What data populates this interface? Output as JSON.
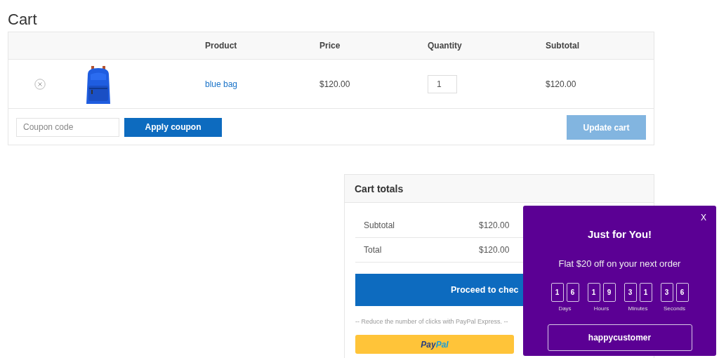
{
  "page_title": "Cart",
  "cart_table": {
    "columns": [
      {},
      {},
      {
        "label": "Product"
      },
      {
        "label": "Price"
      },
      {
        "label": "Quantity"
      },
      {
        "label": "Subtotal"
      }
    ],
    "rows": [
      {
        "product": "blue bag",
        "price": "$120.00",
        "quantity": "1",
        "subtotal": "$120.00"
      }
    ]
  },
  "coupon": {
    "placeholder": "Coupon code",
    "apply_button": "Apply coupon"
  },
  "update_button": {
    "label": "Update cart",
    "disabled": true
  },
  "cart_totals": {
    "title": "Cart totals",
    "rows": [
      {
        "label": "Subtotal",
        "value": "$120.00"
      },
      {
        "label": "Total",
        "value": "$120.00"
      }
    ],
    "checkout_button": "Proceed to chec",
    "paypal_note": "-- Reduce the number of clicks with PayPal Express. --",
    "paypal_button": "PayPal"
  },
  "popup": {
    "close": "X",
    "title": "Just for You!",
    "message": "Flat $20 off on your next order",
    "countdown": [
      {
        "digits": [
          "1",
          "6"
        ],
        "label": "Days"
      },
      {
        "digits": [
          "1",
          "9"
        ],
        "label": "Hours"
      },
      {
        "digits": [
          "3",
          "1"
        ],
        "label": "Minutes"
      },
      {
        "digits": [
          "3",
          "6"
        ],
        "label": "Seconds"
      }
    ],
    "coupon_code": "happycustomer"
  }
}
